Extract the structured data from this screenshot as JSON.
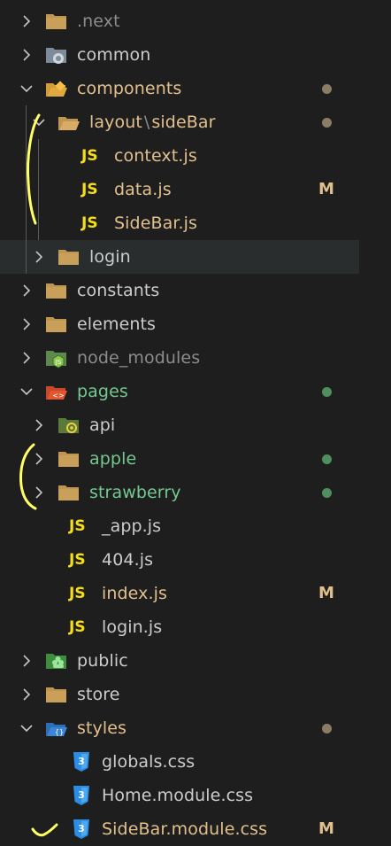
{
  "colors": {
    "background": "#1e1e1e",
    "selection": "#2a2d2e",
    "modified": "#e2c08d",
    "untracked": "#73c991",
    "ignored": "#8c8c8c",
    "default": "#cccccc",
    "js_badge": "#f5de19",
    "css_icon": "#2b8ee6",
    "folder": "#c09553",
    "annotation": "#ffff66"
  },
  "explorer": {
    "items": [
      {
        "label": ".next",
        "icon": "next-folder-icon",
        "state": "ignored",
        "expanded": false,
        "badge": ""
      },
      {
        "label": "common",
        "icon": "common-folder-icon",
        "state": "default",
        "expanded": false,
        "badge": ""
      },
      {
        "label": "components",
        "icon": "components-folder-icon",
        "state": "modified",
        "expanded": true,
        "badge": "dot"
      },
      {
        "label": "layout",
        "label_sep": "\\",
        "label_tail": "sideBar",
        "icon": "folder-open-icon",
        "state": "modified",
        "expanded": true,
        "badge": "dot"
      },
      {
        "label": "context.js",
        "icon": "js-file-icon",
        "state": "modified",
        "badge": ""
      },
      {
        "label": "data.js",
        "icon": "js-file-icon",
        "state": "modified",
        "badge": "M"
      },
      {
        "label": "SideBar.js",
        "icon": "js-file-icon",
        "state": "modified",
        "badge": ""
      },
      {
        "label": "login",
        "icon": "folder-icon",
        "state": "default",
        "expanded": false,
        "badge": "",
        "selected": true
      },
      {
        "label": "constants",
        "icon": "folder-icon",
        "state": "default",
        "expanded": false,
        "badge": ""
      },
      {
        "label": "elements",
        "icon": "folder-icon",
        "state": "default",
        "expanded": false,
        "badge": ""
      },
      {
        "label": "node_modules",
        "icon": "node-modules-folder-icon",
        "state": "ignored",
        "expanded": false,
        "badge": ""
      },
      {
        "label": "pages",
        "icon": "pages-folder-icon",
        "state": "untracked",
        "expanded": true,
        "badge": "dot"
      },
      {
        "label": "api",
        "icon": "api-folder-icon",
        "state": "default",
        "expanded": false,
        "badge": ""
      },
      {
        "label": "apple",
        "icon": "folder-icon",
        "state": "untracked",
        "expanded": false,
        "badge": "dot"
      },
      {
        "label": "strawberry",
        "icon": "folder-icon",
        "state": "untracked",
        "expanded": false,
        "badge": "dot"
      },
      {
        "label": "_app.js",
        "icon": "js-file-icon",
        "state": "default",
        "badge": ""
      },
      {
        "label": "404.js",
        "icon": "js-file-icon",
        "state": "default",
        "badge": ""
      },
      {
        "label": "index.js",
        "icon": "js-file-icon",
        "state": "modified",
        "badge": "M"
      },
      {
        "label": "login.js",
        "icon": "js-file-icon",
        "state": "default",
        "badge": ""
      },
      {
        "label": "public",
        "icon": "public-folder-icon",
        "state": "default",
        "expanded": false,
        "badge": ""
      },
      {
        "label": "store",
        "icon": "folder-icon",
        "state": "default",
        "expanded": false,
        "badge": ""
      },
      {
        "label": "styles",
        "icon": "styles-folder-icon",
        "state": "modified",
        "expanded": true,
        "badge": "dot"
      },
      {
        "label": "globals.css",
        "icon": "css-file-icon",
        "state": "default",
        "badge": ""
      },
      {
        "label": "Home.module.css",
        "icon": "css-file-icon",
        "state": "default",
        "badge": ""
      },
      {
        "label": "SideBar.module.css",
        "icon": "css-file-icon",
        "state": "modified",
        "badge": "M"
      }
    ],
    "js_label": "JS"
  }
}
